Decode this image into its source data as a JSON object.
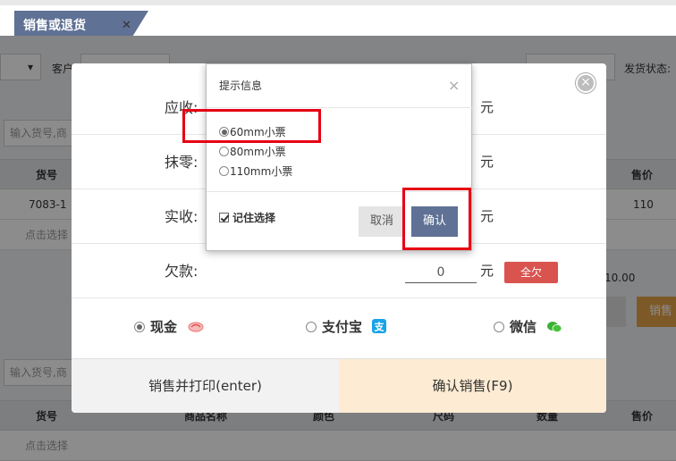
{
  "tab": {
    "label": "销售或退货",
    "close": "✕"
  },
  "background": {
    "customer_label": "客户",
    "ship_status_label": "发货状态:",
    "search_placeholder": "输入货号,商",
    "columns": {
      "sku": "货号",
      "price": "售价",
      "name": "商品名称",
      "color": "颜色",
      "size": "尺码",
      "qty": "数量"
    },
    "row": {
      "sku": "7083-1",
      "price": "110"
    },
    "hint": "点击选择",
    "amount": "10.00",
    "orange_button": "销售"
  },
  "payment_modal": {
    "close": "×",
    "rows": [
      {
        "label": "应收:",
        "value": "",
        "unit": "元"
      },
      {
        "label": "抹零:",
        "value": "",
        "unit": "元"
      },
      {
        "label": "实收:",
        "value": "",
        "unit": "元"
      },
      {
        "label": "欠款:",
        "value": "0",
        "unit": "元"
      }
    ],
    "owe_all_button": "全欠",
    "methods": [
      {
        "label": "现金",
        "selected": true,
        "icon": "cash-icon"
      },
      {
        "label": "支付宝",
        "selected": false,
        "icon": "alipay-icon"
      },
      {
        "label": "微信",
        "selected": false,
        "icon": "wechat-icon"
      }
    ],
    "print_sale_button": "销售并打印(enter)",
    "confirm_sale_button": "确认销售(F9)"
  },
  "print_dialog": {
    "title": "提示信息",
    "close": "×",
    "options": [
      {
        "label": "60mm小票",
        "selected": true
      },
      {
        "label": "80mm小票",
        "selected": false
      },
      {
        "label": "110mm小票",
        "selected": false
      }
    ],
    "remember_label": "记住选择",
    "remember_checked": true,
    "cancel_button": "取消",
    "ok_button": "确认"
  },
  "colors": {
    "accent": "#5f7194",
    "danger": "#d9534f",
    "highlight": "#e60012",
    "confirm_bg": "#fdebd3"
  }
}
